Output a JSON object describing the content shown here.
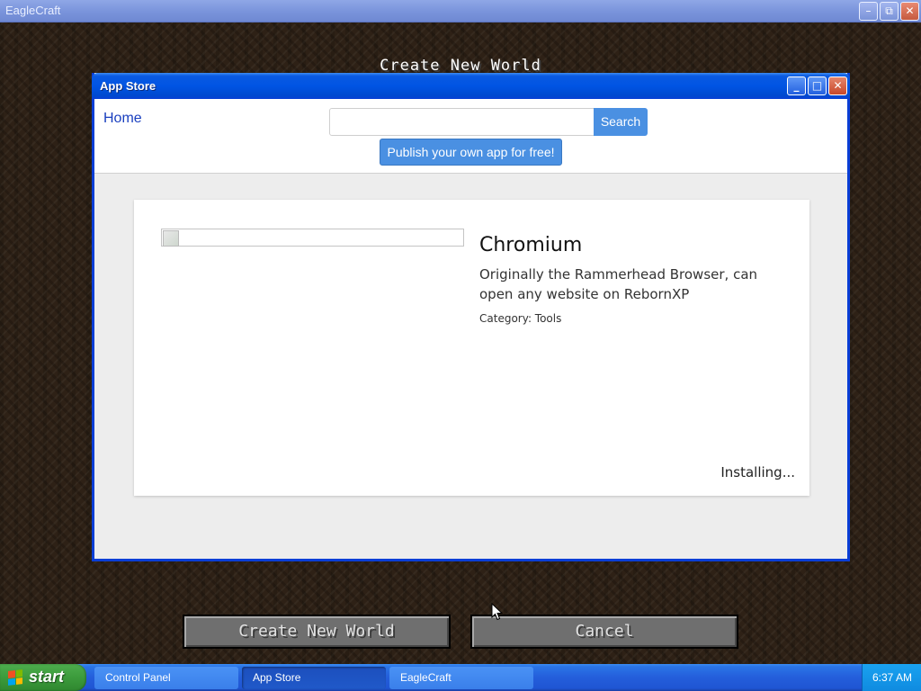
{
  "outer_window": {
    "title": "EagleCraft",
    "controls": {
      "minimize": "–",
      "restore": "⧉",
      "close": "✕"
    }
  },
  "minecraft": {
    "heading": "Create New World",
    "create_button": "Create New World",
    "cancel_button": "Cancel"
  },
  "app_store": {
    "title": "App Store",
    "controls": {
      "minimize": "_",
      "maximize": "□",
      "close": "✕"
    },
    "nav": {
      "home": "Home"
    },
    "search": {
      "value": "",
      "placeholder": "",
      "button": "Search"
    },
    "publish_button": "Publish your own app for free!",
    "app": {
      "name": "Chromium",
      "description": "Originally the Rammerhead Browser, can open any website on RebornXP",
      "category": "Category: Tools",
      "status": "Installing..."
    }
  },
  "taskbar": {
    "start_label": "start",
    "items": [
      {
        "label": "Control Panel",
        "active": false
      },
      {
        "label": "App Store",
        "active": true
      },
      {
        "label": "EagleCraft",
        "active": false
      }
    ],
    "clock": "6:37 AM"
  },
  "colors": {
    "xp_blue": "#0054e3",
    "start_green": "#3c9b3c",
    "button_blue": "#4a90e2",
    "link": "#1a3fbf"
  }
}
